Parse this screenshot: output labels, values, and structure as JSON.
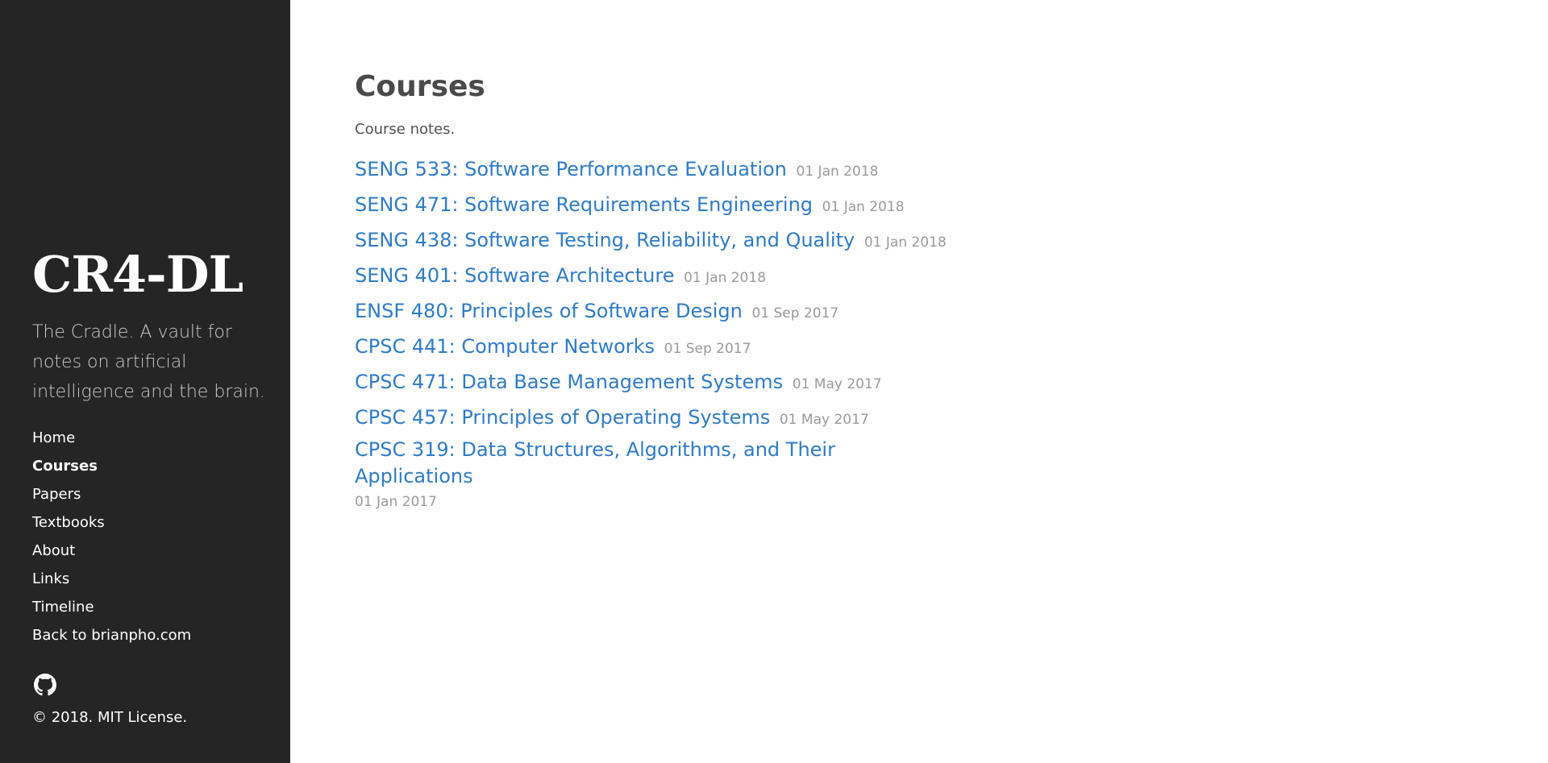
{
  "sidebar": {
    "brand": "CR4-DL",
    "lead": "The Cradle. A vault for notes on artificial intelligence and the brain.",
    "nav": [
      {
        "label": "Home",
        "active": false
      },
      {
        "label": "Courses",
        "active": true
      },
      {
        "label": "Papers",
        "active": false
      },
      {
        "label": "Textbooks",
        "active": false
      },
      {
        "label": "About",
        "active": false
      },
      {
        "label": "Links",
        "active": false
      },
      {
        "label": "Timeline",
        "active": false
      },
      {
        "label": "Back to brianpho.com",
        "active": false
      }
    ],
    "github_icon": "github-icon",
    "copyright": "© 2018. MIT License."
  },
  "main": {
    "title": "Courses",
    "description": "Course notes.",
    "courses": [
      {
        "title": "SENG 533: Software Performance Evaluation",
        "date": "01 Jan 2018"
      },
      {
        "title": "SENG 471: Software Requirements Engineering",
        "date": "01 Jan 2018"
      },
      {
        "title": "SENG 438: Software Testing, Reliability, and Quality",
        "date": "01 Jan 2018"
      },
      {
        "title": "SENG 401: Software Architecture",
        "date": "01 Jan 2018"
      },
      {
        "title": "ENSF 480: Principles of Software Design",
        "date": "01 Sep 2017"
      },
      {
        "title": "CPSC 441: Computer Networks",
        "date": "01 Sep 2017"
      },
      {
        "title": "CPSC 471: Data Base Management Systems",
        "date": "01 May 2017"
      },
      {
        "title": "CPSC 457: Principles of Operating Systems",
        "date": "01 May 2017"
      },
      {
        "title": "CPSC 319: Data Structures, Algorithms, and Their Applications",
        "date": "01 Jan 2017"
      }
    ]
  },
  "colors": {
    "sidebar_bg": "#252525",
    "link": "#2f7bc8",
    "date": "#9a9a9a"
  }
}
